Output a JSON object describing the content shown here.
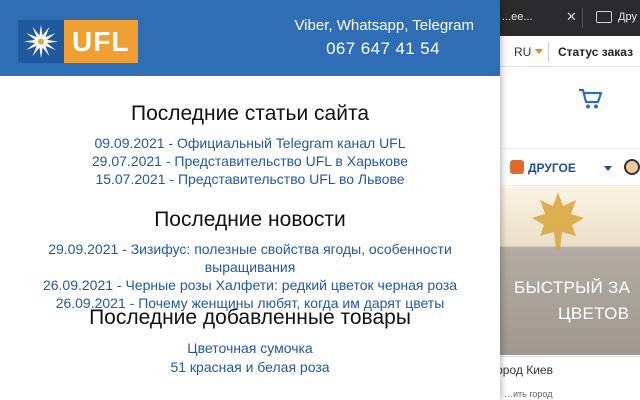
{
  "browser": {
    "tab_text": "...ее...",
    "close_glyph": "✕",
    "bookmark_label": "Дру"
  },
  "site": {
    "language": "RU",
    "order_status": "Статус заказ",
    "nav_other": "ДРУГОЕ",
    "banner_line1": "БЫСТРЫЙ ЗА",
    "banner_line2": "ЦВЕТОВ",
    "city": "город Киев",
    "city_bottom": "…ить город"
  },
  "popup": {
    "logo_text": "UFL",
    "contact_channels": "Viber, Whatsapp, Telegram",
    "phone": "067 647 41 54",
    "sections": [
      {
        "title": "Последние статьи сайта",
        "items": [
          "09.09.2021 - Официальный Telegram канал UFL",
          "29.07.2021 - Представительство UFL в Харькове",
          "15.07.2021 - Представительство UFL во Львове"
        ]
      },
      {
        "title": "Последние новости",
        "items": [
          "29.09.2021 - Зизифус: полезные свойства ягоды, особенности",
          "выращивания",
          "26.09.2021 - Черные розы Халфети: редкий цветок черная роза",
          "26.09.2021 - Почему женщины любят, когда им дарят цветы"
        ]
      },
      {
        "title": "Последние добавленные товары",
        "items": [
          "Цветочная сумочка",
          "51 красная и белая роза"
        ]
      }
    ]
  },
  "colors": {
    "header_blue": "#2f6db4",
    "logo_orange": "#f0a033",
    "link_blue": "#1f5aa0",
    "accent_orange": "#e88b1a"
  }
}
